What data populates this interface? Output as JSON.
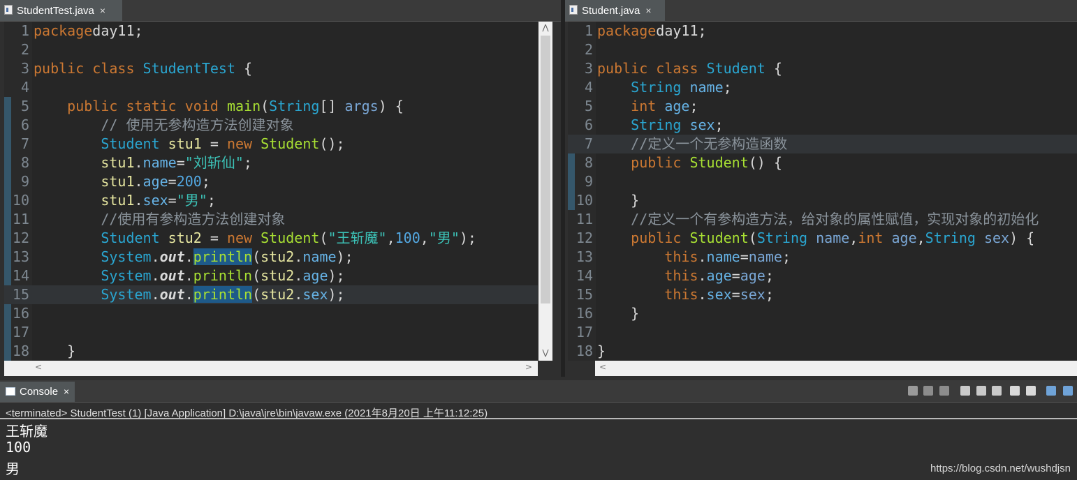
{
  "left_editor": {
    "tab_label": "StudentTest.java",
    "tab_close": "×",
    "lines": [
      {
        "n": "1",
        "toks": [
          [
            "kw",
            "package"
          ],
          [
            "",
            "day11;"
          ]
        ]
      },
      {
        "n": "2",
        "toks": []
      },
      {
        "n": "3",
        "toks": [
          [
            "kw",
            "public class "
          ],
          [
            "ty",
            "StudentTest"
          ],
          [
            "",
            " {"
          ]
        ]
      },
      {
        "n": "4",
        "toks": []
      },
      {
        "n": "5",
        "toks": [
          [
            "",
            "    "
          ],
          [
            "kw",
            "public static void "
          ],
          [
            "mt",
            "main"
          ],
          [
            "",
            "("
          ],
          [
            "ty",
            "String"
          ],
          [
            "",
            "[] "
          ],
          [
            "pm",
            "args"
          ],
          [
            "",
            ") {"
          ]
        ]
      },
      {
        "n": "6",
        "toks": [
          [
            "",
            "        "
          ],
          [
            "cm",
            "// 使用无参构造方法创建对象"
          ]
        ]
      },
      {
        "n": "7",
        "toks": [
          [
            "",
            "        "
          ],
          [
            "ty",
            "Student "
          ],
          [
            "vr",
            "stu1"
          ],
          [
            "",
            " = "
          ],
          [
            "kw",
            "new "
          ],
          [
            "mt",
            "Student"
          ],
          [
            "",
            "();"
          ]
        ]
      },
      {
        "n": "8",
        "toks": [
          [
            "",
            "        "
          ],
          [
            "vr",
            "stu1"
          ],
          [
            "",
            "."
          ],
          [
            "fd",
            "name"
          ],
          [
            "",
            "="
          ],
          [
            "st",
            "\"刘斩仙\""
          ],
          [
            "",
            ";"
          ]
        ]
      },
      {
        "n": "9",
        "toks": [
          [
            "",
            "        "
          ],
          [
            "vr",
            "stu1"
          ],
          [
            "",
            "."
          ],
          [
            "fd",
            "age"
          ],
          [
            "",
            "="
          ],
          [
            "nm",
            "200"
          ],
          [
            "",
            ";"
          ]
        ]
      },
      {
        "n": "10",
        "toks": [
          [
            "",
            "        "
          ],
          [
            "vr",
            "stu1"
          ],
          [
            "",
            "."
          ],
          [
            "fd",
            "sex"
          ],
          [
            "",
            "="
          ],
          [
            "st",
            "\"男\""
          ],
          [
            "",
            ";"
          ]
        ]
      },
      {
        "n": "11",
        "toks": [
          [
            "",
            "        "
          ],
          [
            "cm",
            "//使用有参构造方法创建对象"
          ]
        ]
      },
      {
        "n": "12",
        "toks": [
          [
            "",
            "        "
          ],
          [
            "ty",
            "Student "
          ],
          [
            "vr",
            "stu2"
          ],
          [
            "",
            " = "
          ],
          [
            "kw",
            "new "
          ],
          [
            "mt",
            "Student"
          ],
          [
            "",
            "("
          ],
          [
            "st",
            "\"王斩魔\""
          ],
          [
            "",
            ","
          ],
          [
            "nm",
            "100"
          ],
          [
            "",
            ","
          ],
          [
            "st",
            "\"男\""
          ],
          [
            "",
            ");"
          ]
        ]
      },
      {
        "n": "13",
        "toks": [
          [
            "",
            "        "
          ],
          [
            "ty",
            "System"
          ],
          [
            "",
            "."
          ],
          [
            "it",
            "out"
          ],
          [
            "",
            "."
          ],
          [
            "mt sel",
            "println"
          ],
          [
            "",
            "("
          ],
          [
            "vr",
            "stu2"
          ],
          [
            "",
            "."
          ],
          [
            "fd",
            "name"
          ],
          [
            "",
            ");"
          ]
        ]
      },
      {
        "n": "14",
        "toks": [
          [
            "",
            "        "
          ],
          [
            "ty",
            "System"
          ],
          [
            "",
            "."
          ],
          [
            "it",
            "out"
          ],
          [
            "",
            "."
          ],
          [
            "mt",
            "println"
          ],
          [
            "",
            "("
          ],
          [
            "vr",
            "stu2"
          ],
          [
            "",
            "."
          ],
          [
            "fd",
            "age"
          ],
          [
            "",
            ");"
          ]
        ]
      },
      {
        "n": "15",
        "toks": [
          [
            "",
            "        "
          ],
          [
            "ty",
            "System"
          ],
          [
            "",
            "."
          ],
          [
            "it",
            "out"
          ],
          [
            "",
            "."
          ],
          [
            "mt sel",
            "println"
          ],
          [
            "",
            "("
          ],
          [
            "vr",
            "stu2"
          ],
          [
            "",
            "."
          ],
          [
            "fd",
            "sex"
          ],
          [
            "",
            ");"
          ]
        ],
        "hl": true
      },
      {
        "n": "16",
        "toks": []
      },
      {
        "n": "17",
        "toks": []
      },
      {
        "n": "18",
        "toks": [
          [
            "",
            "    }"
          ]
        ]
      }
    ]
  },
  "right_editor": {
    "tab_label": "Student.java",
    "tab_close": "×",
    "lines": [
      {
        "n": "1",
        "toks": [
          [
            "kw",
            "package"
          ],
          [
            "",
            "day11;"
          ]
        ]
      },
      {
        "n": "2",
        "toks": []
      },
      {
        "n": "3",
        "toks": [
          [
            "kw",
            "public class "
          ],
          [
            "ty",
            "Student"
          ],
          [
            "",
            " {"
          ]
        ]
      },
      {
        "n": "4",
        "toks": [
          [
            "",
            "    "
          ],
          [
            "ty",
            "String "
          ],
          [
            "fd",
            "name"
          ],
          [
            "",
            ";"
          ]
        ]
      },
      {
        "n": "5",
        "toks": [
          [
            "",
            "    "
          ],
          [
            "kw",
            "int "
          ],
          [
            "fd",
            "age"
          ],
          [
            "",
            ";"
          ]
        ]
      },
      {
        "n": "6",
        "toks": [
          [
            "",
            "    "
          ],
          [
            "ty",
            "String "
          ],
          [
            "fd",
            "sex"
          ],
          [
            "",
            ";"
          ]
        ]
      },
      {
        "n": "7",
        "toks": [
          [
            "",
            "    "
          ],
          [
            "cm",
            "//定义一个无参构造函数"
          ]
        ],
        "hl": true
      },
      {
        "n": "8",
        "toks": [
          [
            "",
            "    "
          ],
          [
            "kw",
            "public "
          ],
          [
            "mt",
            "Student"
          ],
          [
            "",
            "() {"
          ]
        ]
      },
      {
        "n": "9",
        "toks": []
      },
      {
        "n": "10",
        "toks": [
          [
            "",
            "    }"
          ]
        ]
      },
      {
        "n": "11",
        "toks": [
          [
            "",
            "    "
          ],
          [
            "cm",
            "//定义一个有参构造方法，给对象的属性赋值，实现对象的初始化"
          ]
        ]
      },
      {
        "n": "12",
        "toks": [
          [
            "",
            "    "
          ],
          [
            "kw",
            "public "
          ],
          [
            "mt",
            "Student"
          ],
          [
            "",
            "("
          ],
          [
            "ty",
            "String "
          ],
          [
            "pm",
            "name"
          ],
          [
            "",
            ","
          ],
          [
            "kw",
            "int "
          ],
          [
            "pm",
            "age"
          ],
          [
            "",
            ","
          ],
          [
            "ty",
            "String "
          ],
          [
            "pm",
            "sex"
          ],
          [
            "",
            ") {"
          ]
        ]
      },
      {
        "n": "13",
        "toks": [
          [
            "",
            "        "
          ],
          [
            "kw",
            "this"
          ],
          [
            "",
            "."
          ],
          [
            "fd",
            "name"
          ],
          [
            "",
            "="
          ],
          [
            "pm",
            "name"
          ],
          [
            "",
            ";"
          ]
        ]
      },
      {
        "n": "14",
        "toks": [
          [
            "",
            "        "
          ],
          [
            "kw",
            "this"
          ],
          [
            "",
            "."
          ],
          [
            "fd",
            "age"
          ],
          [
            "",
            "="
          ],
          [
            "pm",
            "age"
          ],
          [
            "",
            ";"
          ]
        ]
      },
      {
        "n": "15",
        "toks": [
          [
            "",
            "        "
          ],
          [
            "kw",
            "this"
          ],
          [
            "",
            "."
          ],
          [
            "fd",
            "sex"
          ],
          [
            "",
            "="
          ],
          [
            "pm",
            "sex"
          ],
          [
            "",
            ";"
          ]
        ]
      },
      {
        "n": "16",
        "toks": [
          [
            "",
            "    }"
          ]
        ]
      },
      {
        "n": "17",
        "toks": []
      },
      {
        "n": "18",
        "toks": [
          [
            "",
            "}"
          ]
        ]
      }
    ]
  },
  "console": {
    "tab_label": "Console",
    "tab_close": "×",
    "description": "<terminated> StudentTest (1) [Java Application] D:\\java\\jre\\bin\\javaw.exe (2021年8月20日 上午11:12:25)",
    "output": [
      "王斩魔",
      "100",
      "男"
    ],
    "toolbar_icons": [
      "terminate-icon",
      "remove-launch-icon",
      "remove-all-icon",
      "clear-console-icon",
      "scroll-lock-icon",
      "word-wrap-icon",
      "show-stdout-icon",
      "show-stderr-icon",
      "pin-console-icon",
      "open-console-icon"
    ]
  },
  "watermark": "https://blog.csdn.net/wushdjsn",
  "colors": {
    "keyword": "#cc7832",
    "type": "#2aa6d1",
    "method": "#a8e033",
    "string": "#3cc2b7",
    "comment": "#8a939b"
  }
}
